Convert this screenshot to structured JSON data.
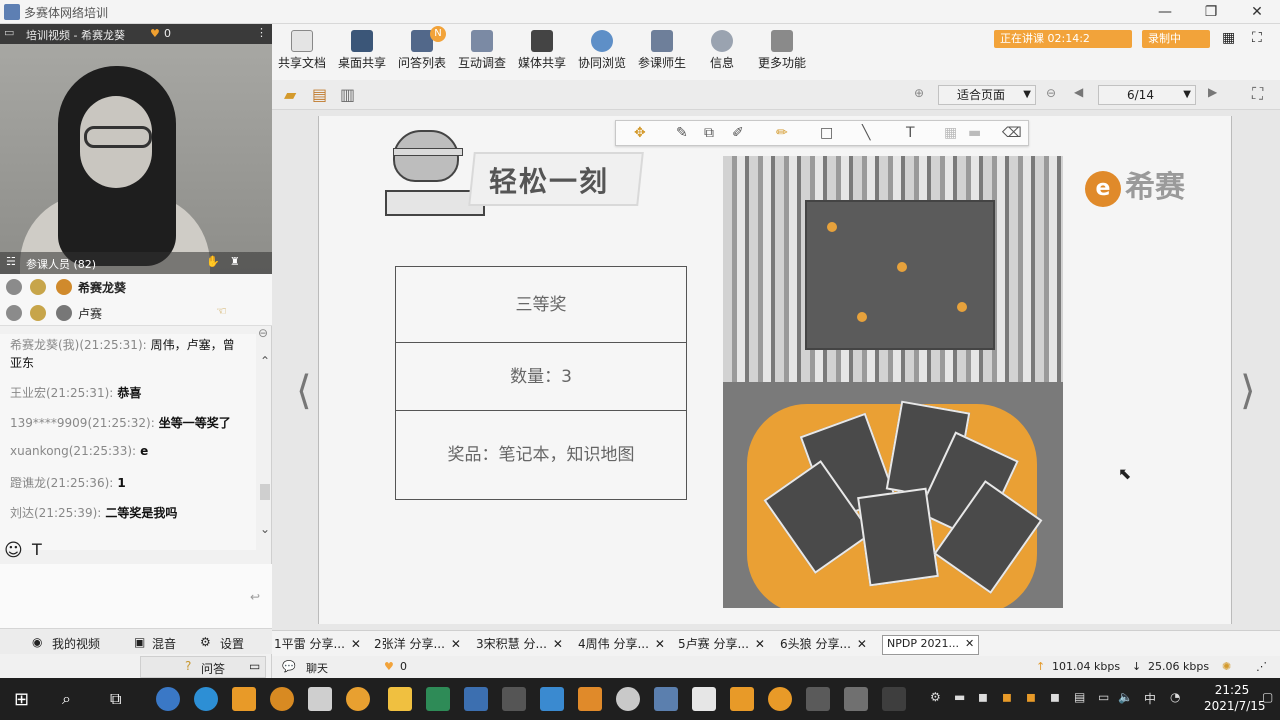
{
  "window": {
    "title": "多赛体网络培训"
  },
  "video_panel": {
    "header_title": "培训视频 - 希赛龙葵",
    "like_count": "0",
    "participants_label": "参课人员 (82)"
  },
  "roster": [
    {
      "name": "希赛龙葵"
    },
    {
      "name": "卢赛"
    }
  ],
  "chat": {
    "messages": [
      {
        "who": "希赛龙葵(我)(21:25:31):",
        "text": "周伟，卢塞，曾"
      },
      {
        "who": "",
        "text": "亚东"
      },
      {
        "who": "王业宏(21:25:31):",
        "text": "恭喜"
      },
      {
        "who": "139****9909(21:25:32):",
        "text": "坐等一等奖了"
      },
      {
        "who": "xuankong(21:25:33):",
        "text": "e"
      },
      {
        "who": "蹬谯龙(21:25:36):",
        "text": "1"
      },
      {
        "who": "刘达(21:25:39):",
        "text": "二等奖是我吗"
      }
    ]
  },
  "left_bottom": {
    "my_video": "我的视频",
    "mix": "混音",
    "settings": "设置",
    "qa": "问答",
    "chat_tab": "聊天",
    "chat_count": "0"
  },
  "toolbar": {
    "items": [
      {
        "label": "共享文档"
      },
      {
        "label": "桌面共享"
      },
      {
        "label": "问答列表"
      },
      {
        "label": "互动调查"
      },
      {
        "label": "媒体共享"
      },
      {
        "label": "协同浏览"
      },
      {
        "label": "参课师生"
      },
      {
        "label": "信息"
      },
      {
        "label": "更多功能"
      }
    ],
    "qa_badge": "N",
    "live_status": "正在讲课 02:14:2",
    "record_status": "录制中"
  },
  "doc_toolbar": {
    "zoom": "适合页面",
    "page": "6/14"
  },
  "slide": {
    "title": "轻松一刻",
    "logo_text": "希赛",
    "prize_rows": [
      "三等奖",
      "数量：3",
      "奖品：笔记本，知识地图"
    ]
  },
  "doc_tabs": [
    {
      "label": "1平雷 分享..."
    },
    {
      "label": "2张洋 分享..."
    },
    {
      "label": "3宋积慧 分..."
    },
    {
      "label": "4周伟 分享..."
    },
    {
      "label": "5卢赛 分享..."
    },
    {
      "label": "6头狼 分享..."
    },
    {
      "label": "NPDP 2021..."
    }
  ],
  "status": {
    "up_speed": "101.04 kbps",
    "down_speed": "25.06 kbps"
  },
  "taskbar": {
    "time": "21:25",
    "date": "2021/7/15",
    "ime": "中"
  },
  "colors": {
    "accent_orange": "#f2a33a",
    "toolbar_bg": "#f4f4f4",
    "taskbar_bg": "#1f1f1f"
  }
}
